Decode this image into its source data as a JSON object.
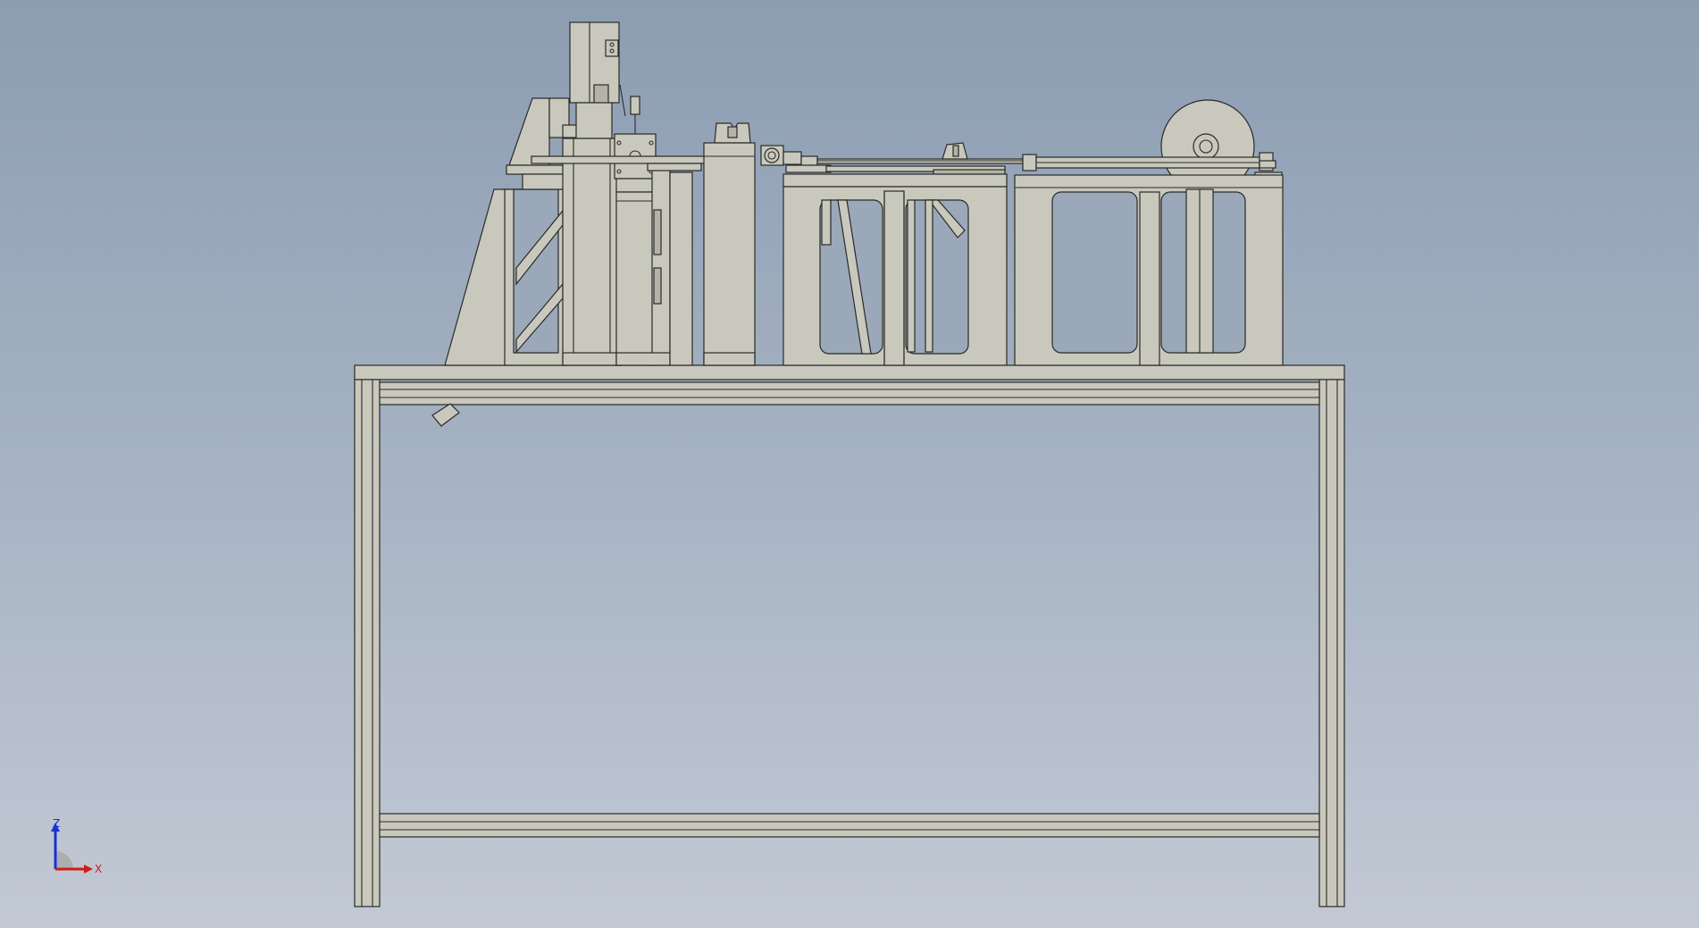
{
  "viewport": {
    "background_top": "#8c9db2",
    "background_bottom": "#c2c9d4",
    "model_color": "#c9c8bc",
    "edge_color": "#2a2a28"
  },
  "triad": {
    "z_label": "Z",
    "x_label": "X",
    "z_color": "#1a2fd6",
    "x_color": "#d21a1a"
  }
}
